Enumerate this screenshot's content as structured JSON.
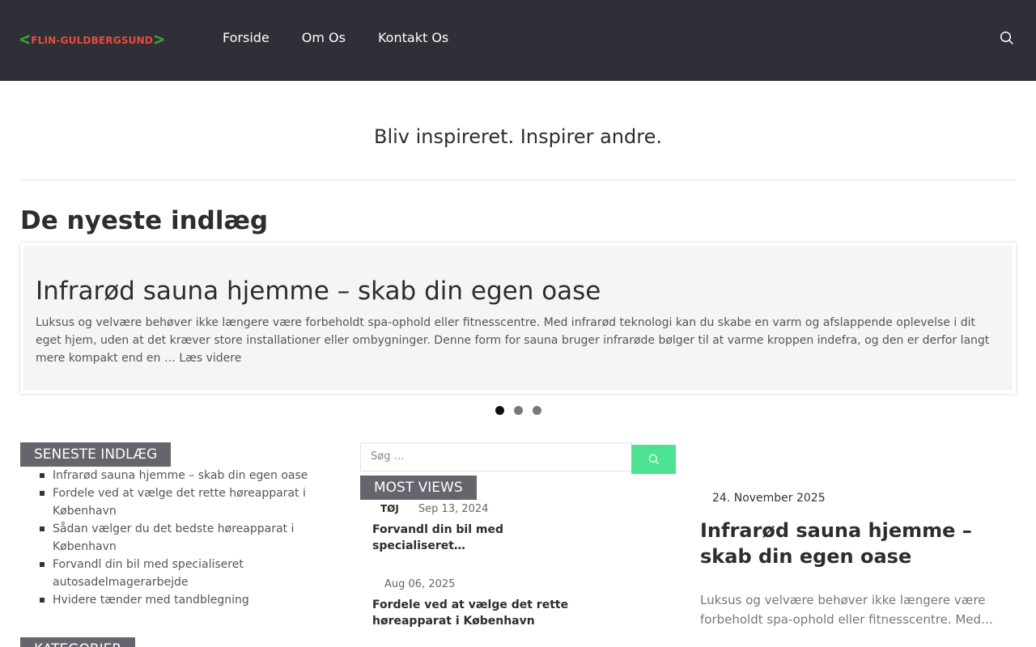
{
  "header": {
    "logo_text": "FLIN-GULDBERGSUND",
    "nav": [
      "Forside",
      "Om Os",
      "Kontakt Os"
    ],
    "search_icon": "search-icon"
  },
  "tagline": "Bliv inspireret. Inspirer andre.",
  "latest": {
    "title": "De nyeste indlæg",
    "slide": {
      "title": "Infrarød sauna hjemme – skab din egen oase",
      "excerpt": "Luksus og velvære behøver ikke længere være forbeholdt spa-ophold eller fitnesscentre. Med infrarød teknologi kan du skabe en varm og afslappende oplevelse i dit eget hjem, uden at det kræver store installationer eller ombygninger. Denne form for sauna bruger infrarøde bølger til at varme kroppen indefra, og den er derfor langt mere kompakt end en …",
      "read_more": "Læs videre"
    },
    "dots": 3,
    "active_dot": 0
  },
  "recent": {
    "title": "SENESTE INDLÆG",
    "items": [
      "Infrarød sauna hjemme – skab din egen oase",
      "Fordele ved at vælge det rette høreapparat i København",
      "Sådan vælger du det bedste høreapparat i København",
      "Forvandl din bil med specialiseret autosadelmagerarbejde",
      "Hvidere tænder med tandblegning"
    ]
  },
  "categories": {
    "title": "KATEGORIER"
  },
  "search": {
    "placeholder": "Søg …"
  },
  "most_views": {
    "title": "MOST VIEWS",
    "items": [
      {
        "category": "TØJ",
        "date": "Sep 13, 2024",
        "title": "Forvandl din bil med specialiseret…"
      },
      {
        "category": "",
        "date": "Aug 06, 2025",
        "title": "Fordele ved at vælge det rette høreapparat i København"
      }
    ]
  },
  "featured": {
    "date": "24. November 2025",
    "title": "Infrarød sauna hjemme – skab din egen oase",
    "excerpt": "Luksus og velvære behøver ikke længere være forbeholdt spa-ophold eller fitnesscentre. Med…"
  },
  "colors": {
    "header_bg": "#2f2f37",
    "logo_green": "#3fa535",
    "logo_red": "#e84c3d",
    "widget_title_bg": "#65656d",
    "search_button": "#4ee393"
  }
}
